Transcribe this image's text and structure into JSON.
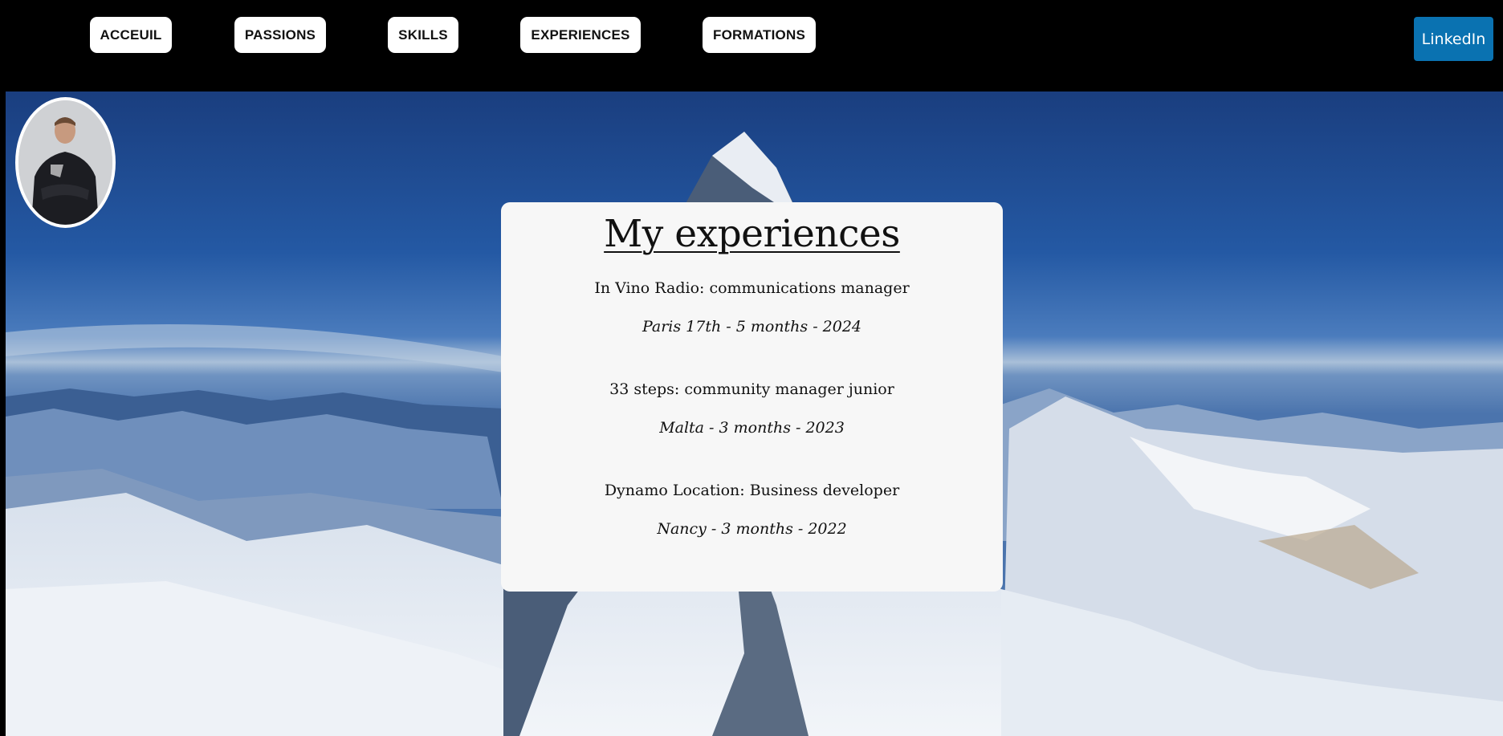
{
  "nav": {
    "items": [
      {
        "label": "ACCEUIL"
      },
      {
        "label": "PASSIONS"
      },
      {
        "label": "SKILLS"
      },
      {
        "label": "EXPERIENCES"
      },
      {
        "label": "FORMATIONS"
      }
    ],
    "linkedin_label": "LinkedIn"
  },
  "profile": {
    "avatar_icon": "profile-photo"
  },
  "card": {
    "title": "My experiences",
    "experiences": [
      {
        "role": "In Vino Radio: communications manager",
        "meta": "Paris 17th - 5 months - 2024"
      },
      {
        "role": "33 steps: community manager junior",
        "meta": "Malta - 3 months - 2023"
      },
      {
        "role": "Dynamo Location: Business developer",
        "meta": "Nancy - 3 months - 2022"
      }
    ]
  },
  "colors": {
    "linkedin": "#0a72b1",
    "topbar": "#000000",
    "card": "#f7f7f7"
  }
}
